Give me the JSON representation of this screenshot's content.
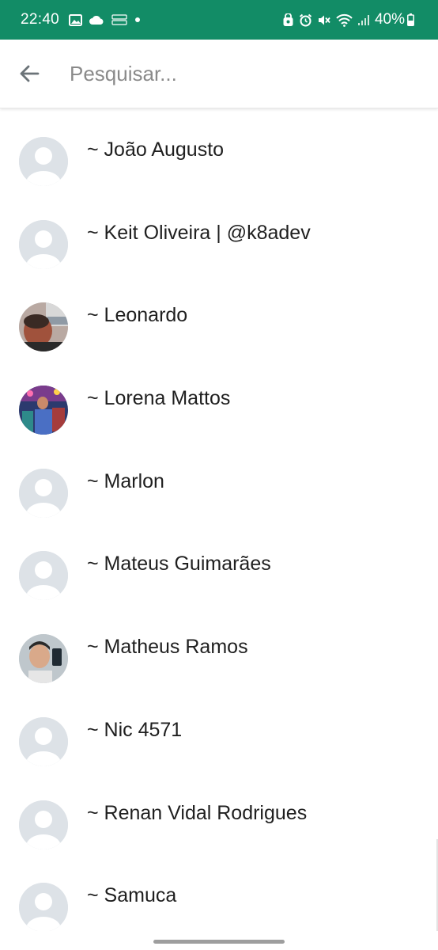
{
  "status_bar": {
    "time": "22:40",
    "battery_percent": "40%",
    "icons_left": [
      "image-icon",
      "cloud-icon",
      "photo-story-icon",
      "dot-icon"
    ],
    "icons_right": [
      "alarm-lock-icon",
      "alarm-clock-icon",
      "mute-icon",
      "wifi-icon",
      "signal-icon",
      "battery-icon"
    ]
  },
  "search": {
    "placeholder": "Pesquisar...",
    "value": ""
  },
  "contacts": [
    {
      "name": "~ João Augusto",
      "avatar": "default"
    },
    {
      "name": "~ Keit Oliveira | @k8adev",
      "avatar": "default"
    },
    {
      "name": "~ Leonardo",
      "avatar": "photo"
    },
    {
      "name": "~ Lorena Mattos",
      "avatar": "photo"
    },
    {
      "name": "~ Marlon",
      "avatar": "default"
    },
    {
      "name": "~ Mateus Guimarães",
      "avatar": "default"
    },
    {
      "name": "~ Matheus Ramos",
      "avatar": "photo"
    },
    {
      "name": "~ Nic 4571",
      "avatar": "default"
    },
    {
      "name": "~ Renan Vidal Rodrigues",
      "avatar": "default"
    },
    {
      "name": "~ Samuca",
      "avatar": "default"
    }
  ],
  "colors": {
    "status_bar": "#128c66",
    "avatar_placeholder_bg": "#dde2e7",
    "avatar_placeholder_fg": "#ffffff"
  }
}
